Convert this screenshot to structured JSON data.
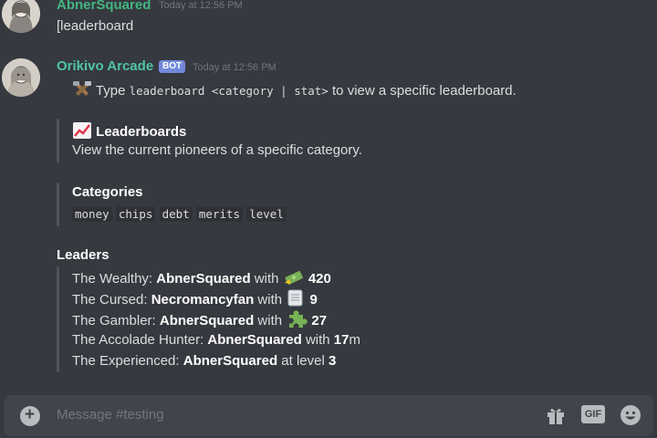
{
  "messages": [
    {
      "author": "AbnerSquared",
      "timestamp": "Today at 12:56 PM",
      "text": "[leaderboard"
    },
    {
      "author": "Orikivo Arcade",
      "badge": "BOT",
      "timestamp": "Today at 12:56 PM",
      "intro_prefix": "Type ",
      "intro_code": "leaderboard <category | stat>",
      "intro_suffix": " to view a specific leaderboard.",
      "embed_title": "Leaderboards",
      "embed_description": "View the current pioneers of a specific category.",
      "categories_title": "Categories",
      "categories": [
        "money",
        "chips",
        "debt",
        "merits",
        "level"
      ],
      "leaders_title": "Leaders",
      "leaders": [
        {
          "label": "The Wealthy: ",
          "name": "AbnerSquared",
          "connector": " with ",
          "value": "420",
          "suffix": "",
          "icon": "money-icon"
        },
        {
          "label": "The Cursed: ",
          "name": "Necromancyfan",
          "connector": " with ",
          "value": "9",
          "suffix": "",
          "icon": "scroll-icon"
        },
        {
          "label": "The Gambler: ",
          "name": "AbnerSquared",
          "connector": " with ",
          "value": "27",
          "suffix": "",
          "icon": "puzzle-icon"
        },
        {
          "label": "The Accolade Hunter: ",
          "name": "AbnerSquared",
          "connector": " with ",
          "value": "17",
          "suffix": "m",
          "icon": ""
        },
        {
          "label": "The Experienced: ",
          "name": "AbnerSquared",
          "connector": " at level ",
          "value": "3",
          "suffix": "",
          "icon": ""
        }
      ]
    }
  ],
  "composer": {
    "placeholder": "Message #testing",
    "gif_label": "GIF"
  },
  "colors": {
    "background": "#36393f",
    "username_green": "#43b581",
    "username_teal": "#4fc3a9",
    "bot_badge": "#7289da",
    "embed_bar": "#4f545c"
  }
}
